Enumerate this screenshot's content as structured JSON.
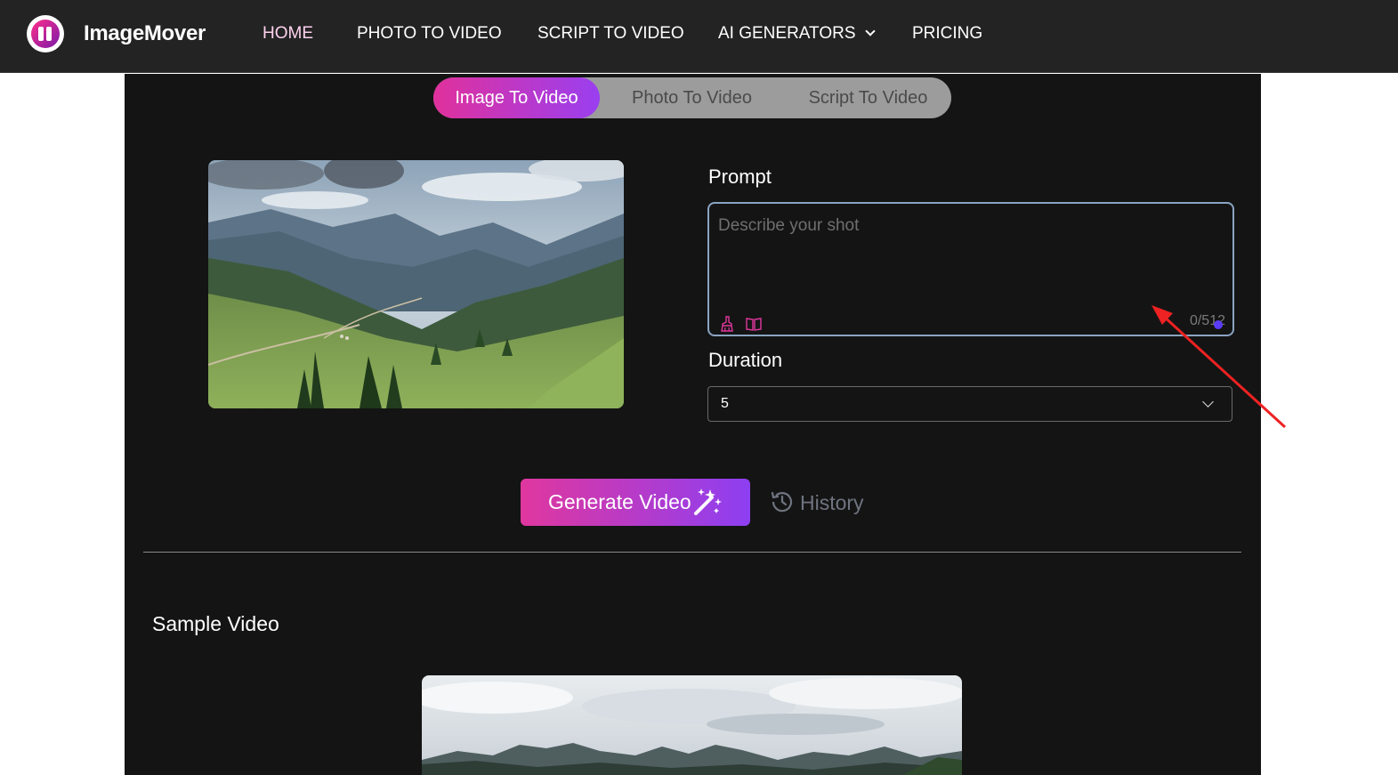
{
  "app": {
    "name": "ImageMover"
  },
  "nav": {
    "items": [
      {
        "label": "HOME",
        "active": true
      },
      {
        "label": "PHOTO TO VIDEO"
      },
      {
        "label": "SCRIPT TO VIDEO"
      },
      {
        "label": "AI GENERATORS",
        "has_dropdown": true
      },
      {
        "label": "PRICING"
      }
    ]
  },
  "mode_tabs": [
    {
      "label": "Image To Video",
      "active": true
    },
    {
      "label": "Photo To Video"
    },
    {
      "label": "Script To Video"
    }
  ],
  "upload": {
    "image_icon": "landscape-mountain-valley-photo"
  },
  "prompt": {
    "label": "Prompt",
    "placeholder": "Describe your shot",
    "value": "",
    "counter": "0/512",
    "tools": [
      "clean-brush-icon",
      "book-icon"
    ]
  },
  "duration": {
    "label": "Duration",
    "selected": "5"
  },
  "actions": {
    "generate_label": "Generate Video",
    "history_label": "History"
  },
  "sample": {
    "title": "Sample Video"
  },
  "colors": {
    "nav_bg": "#232323",
    "panel_bg": "#141414",
    "accent_pink": "#e0319c",
    "accent_purple": "#9a3ff0",
    "tab_bg": "#9c9c9c",
    "annotation_red": "#ee2222"
  }
}
